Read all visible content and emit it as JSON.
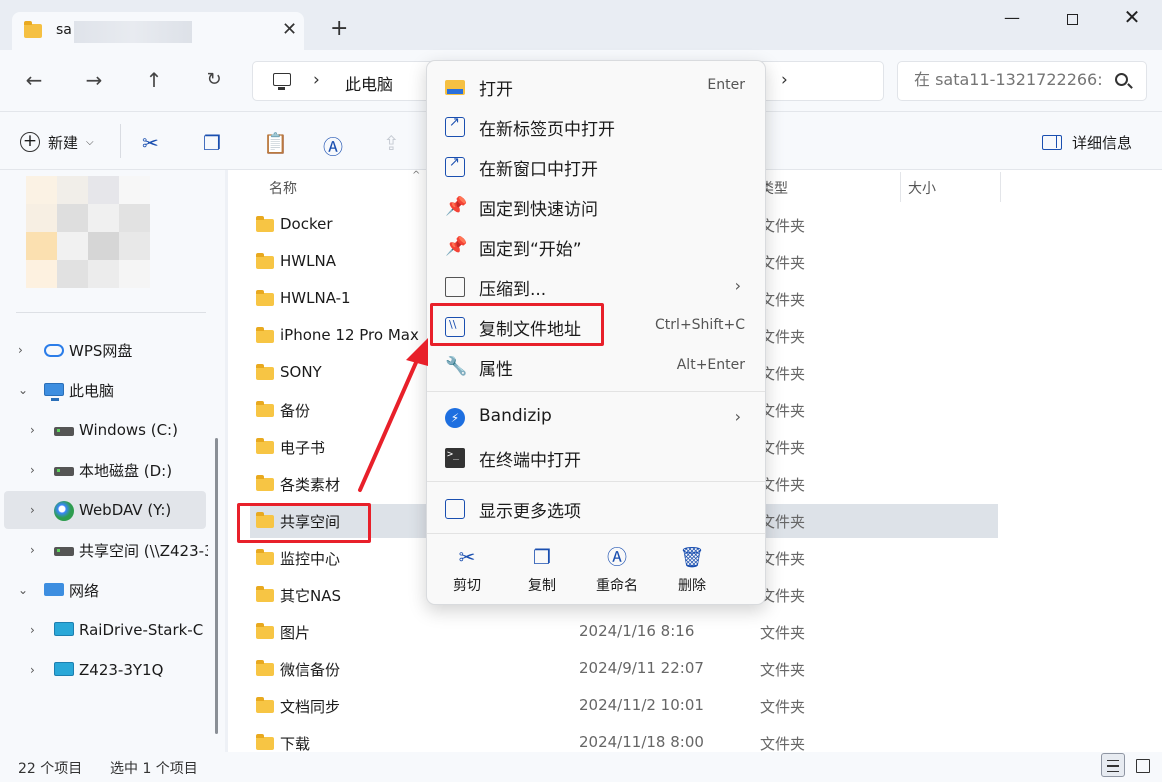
{
  "window": {
    "tab_title": "sa",
    "new_tab_label": "+",
    "close_tab_label": "✕",
    "minimize": "—",
    "close": "✕"
  },
  "nav": {
    "breadcrumb": "此电脑",
    "search_placeholder": "在 sata11-1321722266:"
  },
  "toolbar": {
    "new_label": "新建",
    "details_label": "详细信息"
  },
  "sidebar": {
    "items": [
      {
        "label": "WPS网盘",
        "icon": "cloud-icon"
      },
      {
        "label": "此电脑",
        "icon": "pc-icon"
      },
      {
        "label": "Windows (C:)",
        "icon": "drive-icon"
      },
      {
        "label": "本地磁盘 (D:)",
        "icon": "drive-icon"
      },
      {
        "label": "WebDAV (Y:)",
        "icon": "globe-icon"
      },
      {
        "label": "共享空间 (\\\\Z423-3",
        "icon": "network-drive-icon"
      },
      {
        "label": "网络",
        "icon": "network-icon"
      },
      {
        "label": "RaiDrive-Stark-C",
        "icon": "monitor-icon"
      },
      {
        "label": "Z423-3Y1Q",
        "icon": "monitor-icon"
      }
    ]
  },
  "columns": {
    "name": "名称",
    "type": "类型",
    "size": "大小"
  },
  "files": [
    {
      "name": "Docker",
      "date": "",
      "type": "文件夹"
    },
    {
      "name": "HWLNA",
      "date": "",
      "type": "文件夹"
    },
    {
      "name": "HWLNA-1",
      "date": "",
      "type": "文件夹"
    },
    {
      "name": "iPhone 12 Pro Max",
      "date": "",
      "type": "文件夹"
    },
    {
      "name": "SONY",
      "date": "",
      "type": "文件夹"
    },
    {
      "name": "备份",
      "date": "",
      "type": "文件夹"
    },
    {
      "name": "电子书",
      "date": "",
      "type": "文件夹"
    },
    {
      "name": "各类素材",
      "date": "",
      "type": "文件夹"
    },
    {
      "name": "共享空间",
      "date": "",
      "type": "文件夹"
    },
    {
      "name": "监控中心",
      "date": "",
      "type": "文件夹"
    },
    {
      "name": "其它NAS",
      "date": "",
      "type": "文件夹"
    },
    {
      "name": "图片",
      "date": "2024/1/16 8:16",
      "type": "文件夹"
    },
    {
      "name": "微信备份",
      "date": "2024/9/11 22:07",
      "type": "文件夹"
    },
    {
      "name": "文档同步",
      "date": "2024/11/2 10:01",
      "type": "文件夹"
    },
    {
      "name": "下载",
      "date": "2024/11/18 8:00",
      "type": "文件夹"
    }
  ],
  "status": {
    "count": "22 个项目",
    "selected": "选中 1 个项目"
  },
  "context_menu": {
    "items": [
      {
        "label": "打开",
        "shortcut": "Enter",
        "icon": "folder-open-icon"
      },
      {
        "label": "在新标签页中打开",
        "shortcut": "",
        "icon": "new-tab-icon"
      },
      {
        "label": "在新窗口中打开",
        "shortcut": "",
        "icon": "new-window-icon"
      },
      {
        "label": "固定到快速访问",
        "shortcut": "",
        "icon": "pin-icon"
      },
      {
        "label": "固定到“开始”",
        "shortcut": "",
        "icon": "pin-icon"
      },
      {
        "label": "压缩到...",
        "shortcut": "",
        "icon": "zip-icon"
      },
      {
        "label": "复制文件地址",
        "shortcut": "Ctrl+Shift+C",
        "icon": "copy-path-icon"
      },
      {
        "label": "属性",
        "shortcut": "Alt+Enter",
        "icon": "wrench-icon"
      },
      {
        "label": "Bandizip",
        "shortcut": "",
        "icon": "bandizip-icon"
      },
      {
        "label": "在终端中打开",
        "shortcut": "",
        "icon": "terminal-icon"
      },
      {
        "label": "显示更多选项",
        "shortcut": "",
        "icon": "more-options-icon"
      }
    ],
    "actions": [
      {
        "label": "剪切",
        "icon": "cut-icon"
      },
      {
        "label": "复制",
        "icon": "copy-icon"
      },
      {
        "label": "重命名",
        "icon": "rename-icon"
      },
      {
        "label": "删除",
        "icon": "delete-icon"
      }
    ]
  },
  "colors": {
    "accent": "#1a4fb0",
    "highlight_red": "#e8202a",
    "folder_yellow": "#f7c544",
    "selection": "#dde2e8"
  }
}
